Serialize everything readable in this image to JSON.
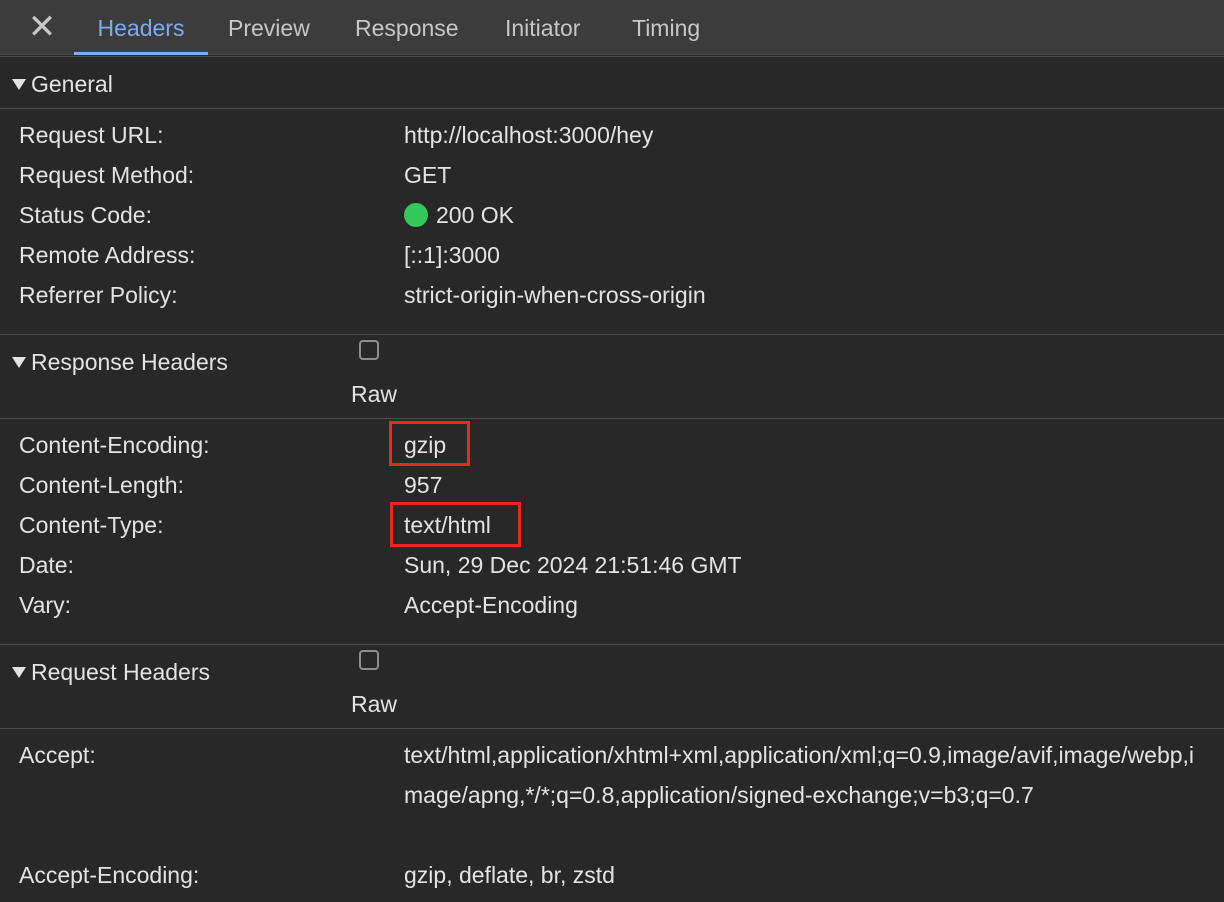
{
  "tabs": {
    "close": "✕",
    "items": [
      {
        "label": "Headers"
      },
      {
        "label": "Preview"
      },
      {
        "label": "Response"
      },
      {
        "label": "Initiator"
      },
      {
        "label": "Timing"
      }
    ]
  },
  "general": {
    "title": "General",
    "rows": [
      {
        "name": "Request URL:",
        "value": "http://localhost:3000/hey"
      },
      {
        "name": "Request Method:",
        "value": "GET"
      },
      {
        "name": "Status Code:",
        "value": "200 OK"
      },
      {
        "name": "Remote Address:",
        "value": "[::1]:3000"
      },
      {
        "name": "Referrer Policy:",
        "value": "strict-origin-when-cross-origin"
      }
    ],
    "status_color": "#34c759"
  },
  "response_headers": {
    "title": "Response Headers",
    "raw_label": "Raw",
    "rows": [
      {
        "name": "Content-Encoding:",
        "value": "gzip"
      },
      {
        "name": "Content-Length:",
        "value": "957"
      },
      {
        "name": "Content-Type:",
        "value": "text/html"
      },
      {
        "name": "Date:",
        "value": "Sun, 29 Dec 2024 21:51:46 GMT"
      },
      {
        "name": "Vary:",
        "value": "Accept-Encoding"
      }
    ]
  },
  "request_headers": {
    "title": "Request Headers",
    "raw_label": "Raw",
    "rows": [
      {
        "name": "Accept:",
        "value": "text/html,application/xhtml+xml,application/xml;q=0.9,image/avif,image/webp,image/apng,*/*;q=0.8,application/signed-exchange;v=b3;q=0.7"
      },
      {
        "name": "Accept-Encoding:",
        "value": "gzip, deflate, br, zstd"
      }
    ]
  },
  "colors": {
    "background": "#282828",
    "tabbar": "#3c3c3c",
    "active_tab": "#7cacf8",
    "highlight": "#e8291c"
  }
}
